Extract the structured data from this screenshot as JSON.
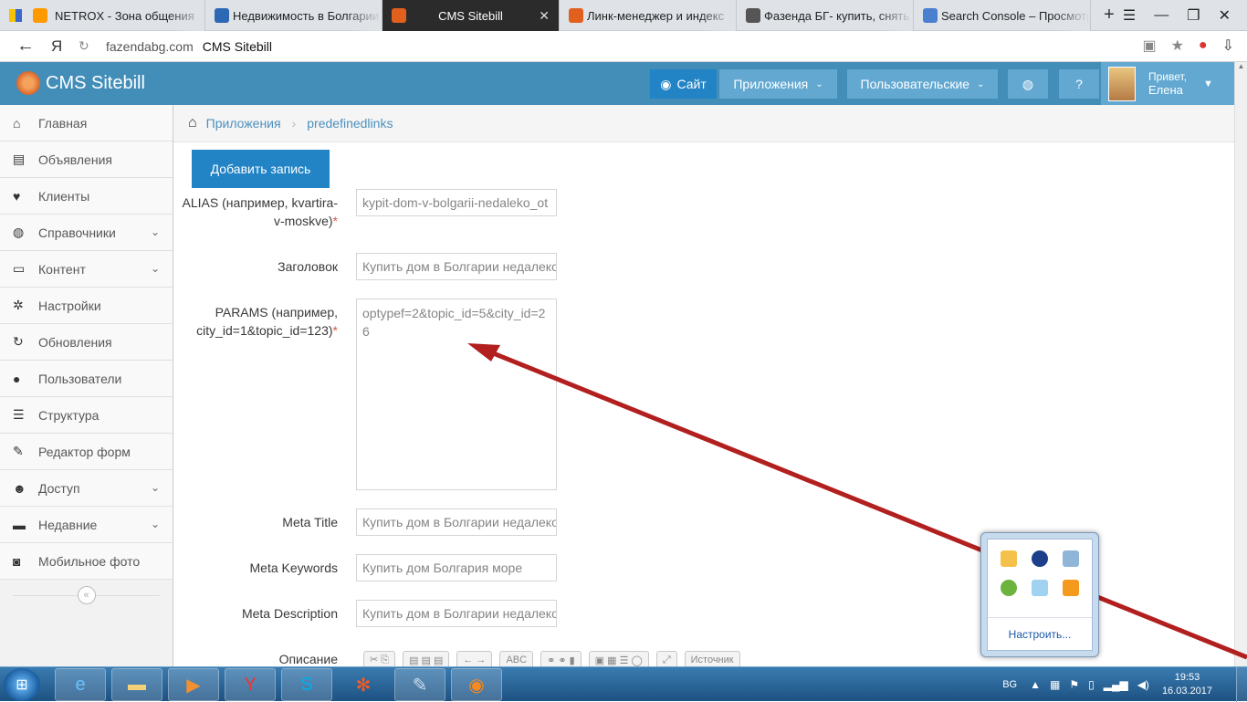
{
  "browser": {
    "tabs": [
      {
        "title": "NETROX - Зона общения",
        "fav": "#ff9900"
      },
      {
        "title": "Недвижимость в Болгарии",
        "fav": "#2c68b4"
      },
      {
        "title": "CMS Sitebill",
        "fav": "#e2601e",
        "active": true
      },
      {
        "title": "Линк-менеджер и индекс",
        "fav": "#e2601e"
      },
      {
        "title": "Фазенда БГ- купить, снять",
        "fav": "#555555"
      },
      {
        "title": "Search Console – Просмотр",
        "fav": "#4a7fd0"
      }
    ],
    "new_tab": "+",
    "address": {
      "domain": "fazendabg.com",
      "title": "CMS Sitebill",
      "ya": "Я"
    }
  },
  "navbar": {
    "brand": "CMS Sitebill",
    "site_label": "Сайт",
    "apps_label": "Приложения",
    "user_label": "Пользовательские",
    "greeting": "Привет,",
    "user_name": "Елена"
  },
  "sidebar": {
    "items": [
      {
        "label": "Главная",
        "icon": "home-icon",
        "glyph": "⌂",
        "chev": false
      },
      {
        "label": "Объявления",
        "icon": "book-icon",
        "glyph": "▤",
        "chev": false
      },
      {
        "label": "Клиенты",
        "icon": "heart-icon",
        "glyph": "♥",
        "chev": false
      },
      {
        "label": "Справочники",
        "icon": "globe-icon",
        "glyph": "◍",
        "chev": true
      },
      {
        "label": "Контент",
        "icon": "laptop-icon",
        "glyph": "▭",
        "chev": true
      },
      {
        "label": "Настройки",
        "icon": "gear-icon",
        "glyph": "✲",
        "chev": false
      },
      {
        "label": "Обновления",
        "icon": "refresh-icon",
        "glyph": "↻",
        "chev": false
      },
      {
        "label": "Пользователи",
        "icon": "user-icon",
        "glyph": "●",
        "chev": false
      },
      {
        "label": "Структура",
        "icon": "list-icon",
        "glyph": "☰",
        "chev": false
      },
      {
        "label": "Редактор форм",
        "icon": "edit-icon",
        "glyph": "✎",
        "chev": false
      },
      {
        "label": "Доступ",
        "icon": "users-icon",
        "glyph": "☻",
        "chev": true
      },
      {
        "label": "Недавние",
        "icon": "desktop-icon",
        "glyph": "▬",
        "chev": true
      },
      {
        "label": "Мобильное фото",
        "icon": "camera-icon",
        "glyph": "◙",
        "chev": false
      }
    ],
    "collapse": "«"
  },
  "breadcrumb": {
    "apps": "Приложения",
    "current": "predefinedlinks"
  },
  "form": {
    "add_button": "Добавить запись",
    "alias_label": "ALIAS (например, kvartira-v-moskve)",
    "alias_value": "kypit-dom-v-bolgarii-nedaleko_ot",
    "title_label": "Заголовок",
    "title_value": "Купить дом в Болгарии недалеко",
    "params_label": "PARAMS (например, city_id=1&topic_id=123)",
    "params_value": "optypef=2&topic_id=5&city_id=26",
    "meta_title_label": "Meta Title",
    "meta_title_value": "Купить дом в Болгарии недалеко",
    "meta_keywords_label": "Meta Keywords",
    "meta_keywords_value": "Купить дом  Болгария море",
    "meta_desc_label": "Meta Description",
    "meta_desc_value": "Купить дом в Болгарии недалеко",
    "desc_label": "Описание",
    "source_button": "Источник",
    "required_mark": "*"
  },
  "tray_popup": {
    "configure": "Настроить..."
  },
  "taskbar": {
    "lang": "BG",
    "time": "19:53",
    "date": "16.03.2017"
  },
  "annotation_color": "#b21f1f"
}
